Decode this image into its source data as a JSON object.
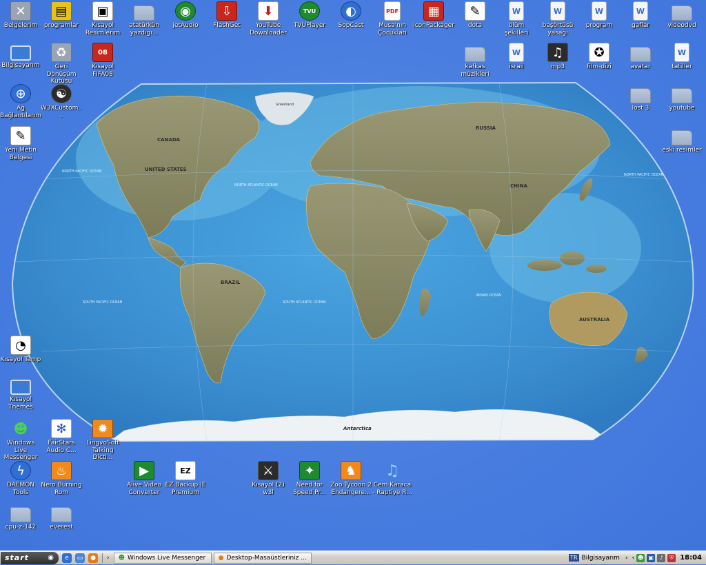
{
  "desktop": {
    "icons": {
      "belgelerim": "Belgelerim",
      "programlar": "programlar",
      "kisayol_resimlerim": "Kısayol Resimlerim",
      "ataturkun": "atatürkün yazdıgı...",
      "jetaudio": "jetAudio",
      "flashget": "FlashGet",
      "youtube_downloader": "YouTube Downloader",
      "tvuplayer": "TVUPlayer",
      "sopcast": "SopCast",
      "musa": "Musa'nın Çocukları",
      "iconpackager": "IconPackager",
      "dota": "dota",
      "olum": "ölüm şekilleri",
      "basortusu": "başörtüsü yasağı",
      "program": "program",
      "gaflar": "gaflar",
      "videodvd": "videodvd",
      "bilgisayarim": "Bilgisayarım",
      "geri_donusum": "Geri Dönüşüm Kutusu",
      "kisayol_fifa": "Kısayol FIFA08",
      "kafkas": "kafkas müzikleri",
      "israil": "israil",
      "mp3": "mp3",
      "film_dizi": "film-dizi",
      "avatar": "avatar",
      "tatiller": "tatiller",
      "ag_baglantilari": "Ağ Bağlantılarım",
      "w3x": "W3XCustom...",
      "lost3": "lost 3",
      "youtube": "youtube",
      "yeni_metin": "Yeni Metin Belgesi",
      "eski_resimler": "eski resimler",
      "kisayol_temp": "Kısayol Temp",
      "kisayol_themes": "Kısayol Themes",
      "wlm": "Windows Live Messenger",
      "fairstars": "FairStars Audio C...",
      "lingvosoft": "LingvoSoft Talking Dicti...",
      "daemon": "DAEMON Tools",
      "nero": "Nero Burning Rom",
      "alive": "Alive Video Converter",
      "ezbackup": "EZ Backup IE Premium",
      "kisayol_w3l": "Kısayol (2) w3l",
      "nfs": "Need for Speed Pr...",
      "zoo": "Zoo Tycoon 2 Endangere...",
      "cem": "Cem Karaca - Raptiye R...",
      "cpuz": "cpu-z-142",
      "everest": "everest"
    },
    "map_labels": {
      "canada": "CANADA",
      "usa": "UNITED STATES",
      "russia": "RUSSIA",
      "china": "CHINA",
      "brazil": "BRAZIL",
      "australia": "AUSTRALIA",
      "antarctica": "Antarctica",
      "n_atlantic": "NORTH ATLANTIC OCEAN",
      "s_atlantic": "SOUTH ATLANTIC OCEAN",
      "n_pacific": "NORTH PACIFIC OCEAN",
      "s_pacific": "SOUTH PACIFIC OCEAN",
      "n_pacific_e": "NORTH PACIFIC OCEAN",
      "indian": "INDIAN OCEAN",
      "greenland": "Greenland"
    }
  },
  "taskbar": {
    "start_label": "start",
    "tasks": [
      "Windows Live Messenger",
      "Desktop-Masaüstleriniz ..."
    ],
    "bilgisayarim": "Bilgisayarım",
    "lang": "TR",
    "clock": "18:04"
  },
  "colors": {
    "desktop_bg": "#4a7fe0",
    "ocean": "#3f8fd2",
    "land": "#8a8a62",
    "taskbar": "#d4d0c8"
  }
}
